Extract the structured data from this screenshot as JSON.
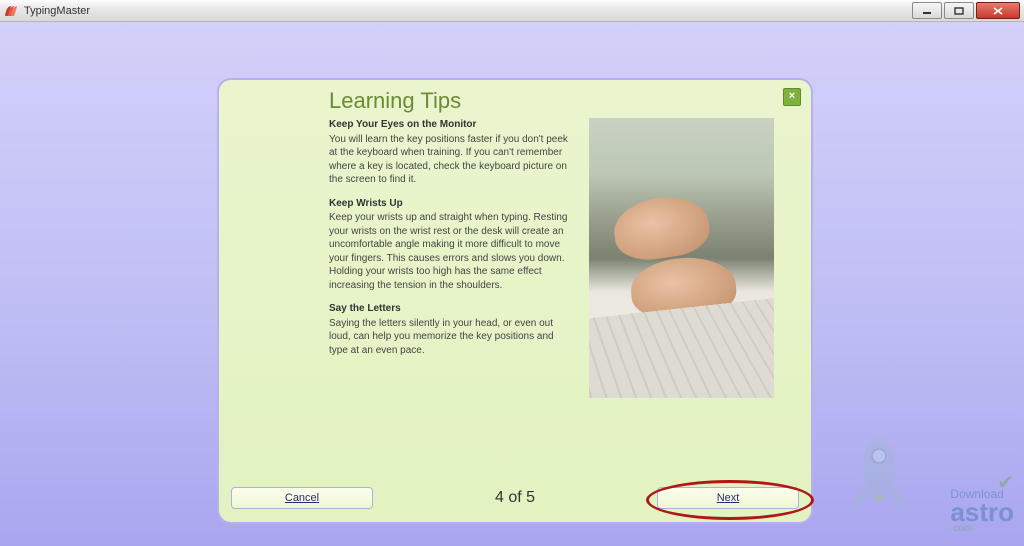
{
  "window": {
    "title": "TypingMaster"
  },
  "dialog": {
    "title": "Learning Tips",
    "sections": [
      {
        "heading": "Keep Your Eyes on the Monitor",
        "body": "You will learn the key positions faster if you don't peek at the keyboard when training. If you can't remember where a key is located, check the keyboard picture on the screen to find it."
      },
      {
        "heading": "Keep Wrists Up",
        "body": "Keep your wrists up and straight when typing. Resting your wrists on the wrist rest or the desk will create an uncomfortable angle making it more difficult to move your fingers. This causes errors and slows you down. Holding your wrists too high has the same effect increasing the tension in the shoulders."
      },
      {
        "heading": "Say the Letters",
        "body": "Saying the letters silently in your head, or even out loud, can help you memorize the key positions and type at an even pace."
      }
    ],
    "page_label": "4 of 5",
    "cancel_label": "Cancel",
    "next_label": "Next"
  },
  "watermark": {
    "line1": "Download",
    "line2": "astro",
    "line3": ".com"
  }
}
